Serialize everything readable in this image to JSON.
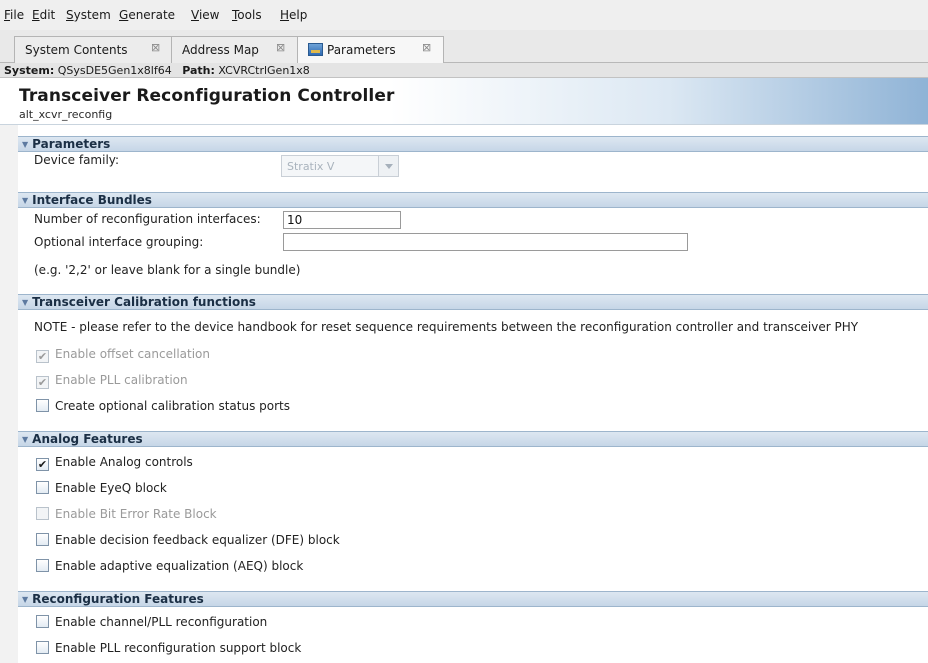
{
  "menubar": {
    "items": [
      {
        "mnemonic": "F",
        "rest": "ile"
      },
      {
        "mnemonic": "E",
        "rest": "dit"
      },
      {
        "mnemonic": "S",
        "rest": "ystem"
      },
      {
        "mnemonic": "G",
        "rest": "enerate"
      },
      {
        "mnemonic": "V",
        "rest": "iew"
      },
      {
        "mnemonic": "T",
        "rest": "ools"
      },
      {
        "mnemonic": "H",
        "rest": "elp"
      }
    ]
  },
  "tabs": [
    {
      "label": "System Contents",
      "close": "⊠",
      "active": false
    },
    {
      "label": "Address Map",
      "close": "⊠",
      "active": false
    },
    {
      "label": "Parameters",
      "close": "⊠",
      "active": true,
      "icon": "parameters-icon"
    }
  ],
  "pathbar": {
    "system_label": "System:",
    "system_value": "QSysDE5Gen1x8lf64",
    "path_label": "Path:",
    "path_value": "XCVRCtrlGen1x8"
  },
  "header": {
    "title": "Transceiver Reconfiguration Controller",
    "subtitle": "alt_xcvr_reconfig"
  },
  "sections": {
    "parameters": {
      "title": "Parameters",
      "device_family_label": "Device family:",
      "device_family_value": "Stratix V"
    },
    "interface_bundles": {
      "title": "Interface Bundles",
      "num_interfaces_label": "Number of reconfiguration interfaces:",
      "num_interfaces_value": "10",
      "grouping_label": "Optional interface grouping:",
      "grouping_value": "",
      "grouping_hint": "(e.g. '2,2' or leave blank for a single bundle)"
    },
    "calibration": {
      "title": "Transceiver Calibration functions",
      "note": "NOTE - please refer to the device handbook for reset sequence requirements between the reconfiguration controller and transceiver PHY",
      "options": [
        {
          "label": "Enable offset cancellation",
          "checked": true,
          "disabled": true
        },
        {
          "label": "Enable PLL calibration",
          "checked": true,
          "disabled": true
        },
        {
          "label": "Create optional calibration status ports",
          "checked": false,
          "disabled": false
        }
      ]
    },
    "analog": {
      "title": "Analog Features",
      "options": [
        {
          "label": "Enable Analog controls",
          "checked": true,
          "disabled": false
        },
        {
          "label": "Enable EyeQ block",
          "checked": false,
          "disabled": false
        },
        {
          "label": "Enable Bit Error Rate Block",
          "checked": false,
          "disabled": true
        },
        {
          "label": "Enable decision feedback equalizer (DFE) block",
          "checked": false,
          "disabled": false
        },
        {
          "label": "Enable adaptive equalization (AEQ) block",
          "checked": false,
          "disabled": false
        }
      ]
    },
    "reconfiguration": {
      "title": "Reconfiguration Features",
      "options": [
        {
          "label": "Enable channel/PLL reconfiguration",
          "checked": false,
          "disabled": false
        },
        {
          "label": "Enable PLL reconfiguration support block",
          "checked": false,
          "disabled": false
        }
      ]
    }
  },
  "check_glyph": "✔"
}
